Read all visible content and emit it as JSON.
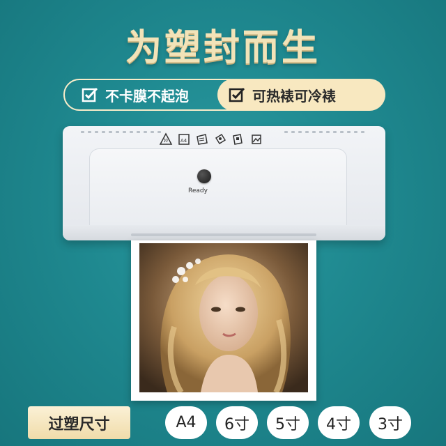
{
  "headline": "为塑封而生",
  "features": [
    {
      "label": "不卡膜不起泡",
      "icon": "checkbox-check-icon"
    },
    {
      "label": "可热裱可冷裱",
      "icon": "checkbox-check-icon"
    }
  ],
  "device": {
    "status_label": "Ready",
    "icons": [
      "warning-hot-icon",
      "a4-paper-icon",
      "laminate-pouch-icon",
      "document-icon",
      "card-icon",
      "photo-icon"
    ]
  },
  "sizes": {
    "label": "过塑尺寸",
    "options": [
      "A4",
      "6寸",
      "5寸",
      "4寸",
      "3寸"
    ]
  },
  "colors": {
    "background": "#1f8990",
    "accent": "#f8e8c0"
  }
}
